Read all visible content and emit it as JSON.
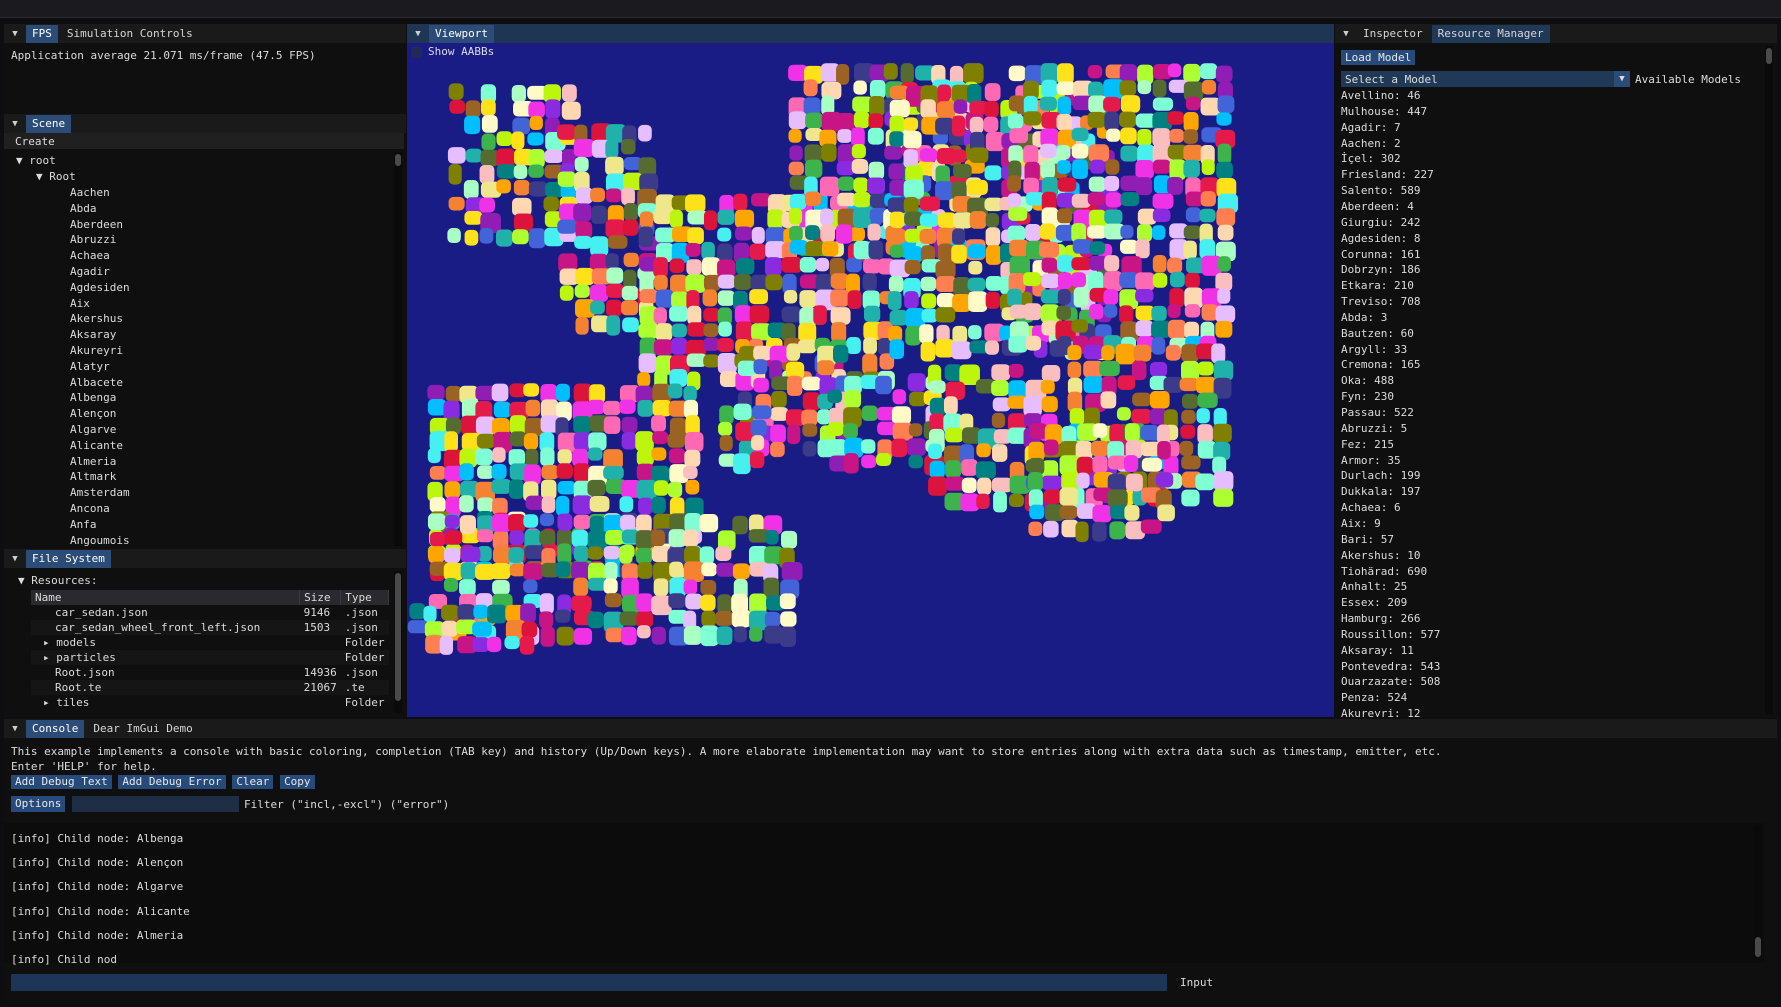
{
  "fps_panel": {
    "tabs": [
      "FPS",
      "Simulation Controls"
    ],
    "text": "Application average 21.071 ms/frame (47.5 FPS)"
  },
  "scene_panel": {
    "tab": "Scene",
    "create_label": "Create",
    "tree_root": "root",
    "tree_child": "Root",
    "items": [
      "Aachen",
      "Abda",
      "Aberdeen",
      "Abruzzi",
      "Achaea",
      "Agadir",
      "Agdesiden",
      "Aix",
      "Akershus",
      "Aksaray",
      "Akureyri",
      "Alatyr",
      "Albacete",
      "Albenga",
      "Alençon",
      "Algarve",
      "Alicante",
      "Almeria",
      "Altmark",
      "Amsterdam",
      "Ancona",
      "Anfa",
      "Angoumois"
    ]
  },
  "file_system": {
    "tab": "File System",
    "resources_label": "Resources:",
    "headers": [
      "Name",
      "Size",
      "Type"
    ],
    "rows": [
      {
        "name": "car_sedan.json",
        "size": "9146",
        "type": ".json",
        "folder": false
      },
      {
        "name": "car_sedan_wheel_front_left.json",
        "size": "1503",
        "type": ".json",
        "folder": false
      },
      {
        "name": "models",
        "size": "",
        "type": "Folder",
        "folder": true
      },
      {
        "name": "particles",
        "size": "",
        "type": "Folder",
        "folder": true
      },
      {
        "name": "Root.json",
        "size": "14936",
        "type": ".json",
        "folder": false
      },
      {
        "name": "Root.te",
        "size": "21067",
        "type": ".te",
        "folder": false
      },
      {
        "name": "tiles",
        "size": "",
        "type": "Folder",
        "folder": true
      }
    ]
  },
  "viewport": {
    "tab": "Viewport",
    "checkbox_label": "Show AABBs"
  },
  "inspector": {
    "tabs": [
      "Inspector",
      "Resource Manager"
    ],
    "load_model": "Load Model",
    "select_value": "Select a Model",
    "select_label": "Available Models",
    "models": [
      "Avellino: 46",
      "Mulhouse: 447",
      "Agadir: 7",
      "Aachen: 2",
      "İçel: 302",
      "Friesland: 227",
      "Salento: 589",
      "Aberdeen: 4",
      "Giurgiu: 242",
      "Agdesiden: 8",
      "Corunna: 161",
      "Dobrzyn: 186",
      "Etkara: 210",
      "Treviso: 708",
      "Abda: 3",
      "Bautzen: 60",
      "Argyll: 33",
      "Cremona: 165",
      "Oka: 488",
      "Fyn: 230",
      "Passau: 522",
      "Abruzzi: 5",
      "Fez: 215",
      "Armor: 35",
      "Durlach: 199",
      "Dukkala: 197",
      "Achaea: 6",
      "Aix: 9",
      "Bari: 57",
      "Akershus: 10",
      "Tiohärad: 690",
      "Anhalt: 25",
      "Essex: 209",
      "Hamburg: 266",
      "Roussillon: 577",
      "Aksaray: 11",
      "Pontevedra: 543",
      "Ouarzazate: 508",
      "Penza: 524",
      "Akureyri: 12"
    ]
  },
  "console": {
    "tabs": [
      "Console",
      "Dear ImGui Demo"
    ],
    "description": "This example implements a console with basic coloring, completion (TAB key) and history (Up/Down keys). A more elaborate implementation may want to store entries along with extra data such as timestamp, emitter, etc.",
    "help": "Enter 'HELP' for help.",
    "buttons": [
      "Add Debug Text",
      "Add Debug Error",
      "Clear",
      "Copy"
    ],
    "options_label": "Options",
    "filter_label": "Filter (\"incl,-excl\") (\"error\")",
    "logs": [
      "[info] Child node: Albenga",
      "[info] Child node: Alençon",
      "[info] Child node: Algarve",
      "[info] Child node: Alicante",
      "[info] Child node: Almeria",
      "[info] Child nod"
    ],
    "input_label": "Input"
  }
}
